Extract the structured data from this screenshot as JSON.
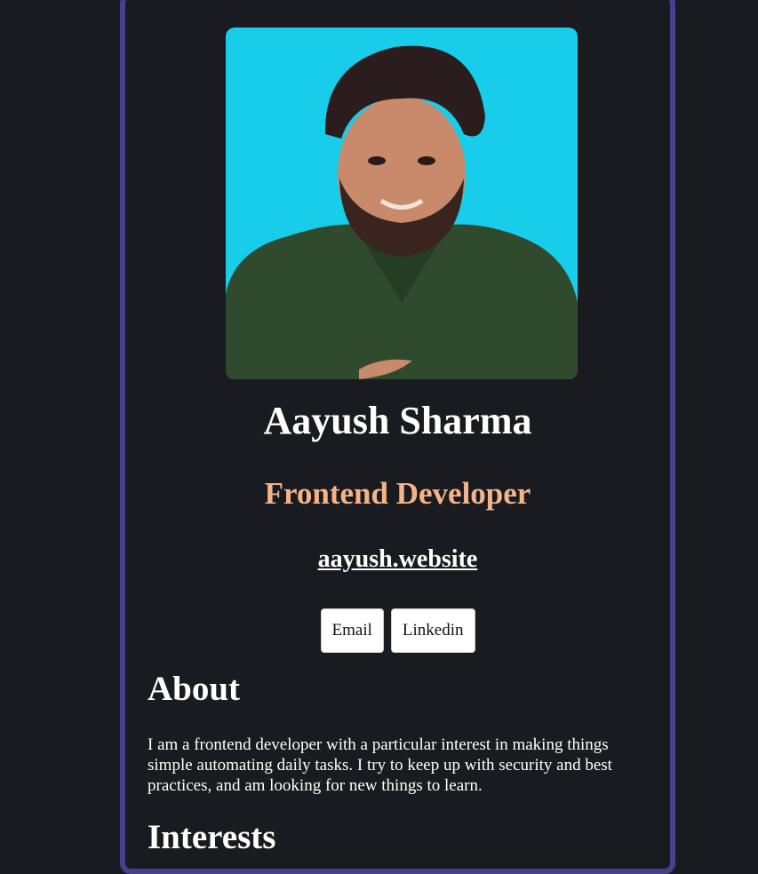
{
  "profile": {
    "name": "Aayush Sharma",
    "role": "Frontend Developer",
    "website": "aayush.website"
  },
  "buttons": {
    "email": "Email",
    "linkedin": "Linkedin"
  },
  "about": {
    "heading": "About",
    "text": "I am a frontend developer with a particular interest in making things simple automating daily tasks. I try to keep up with security and best practices, and am looking for new things to learn."
  },
  "interests": {
    "heading": "Interests"
  },
  "colors": {
    "background": "#1a1b20",
    "card_border": "#4a3f8c",
    "photo_background": "#18cde9",
    "role_accent": "#f4b48a",
    "text": "#ffffff"
  }
}
